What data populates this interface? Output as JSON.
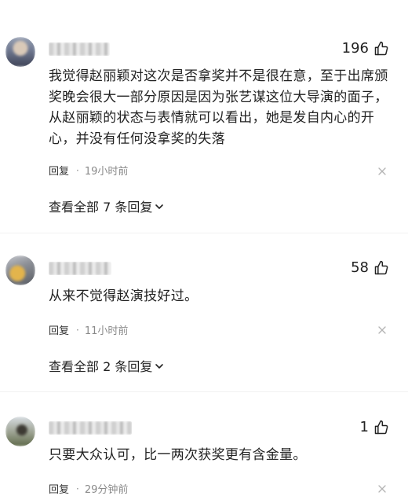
{
  "comments": [
    {
      "likes": "196",
      "text": "我觉得赵丽颖对这次是否拿奖并不是很在意，至于出席颁奖晚会很大一部分原因是因为张艺谋这位大导演的面子，从赵丽颖的状态与表情就可以看出，她是发自内心的开心，并没有任何没拿奖的失落",
      "reply_label": "回复",
      "separator": "·",
      "time": "19小时前",
      "view_all": "查看全部 7 条回复"
    },
    {
      "likes": "58",
      "text": "从来不觉得赵演技好过。",
      "reply_label": "回复",
      "separator": "·",
      "time": "11小时前",
      "view_all": "查看全部 2 条回复"
    },
    {
      "likes": "1",
      "text": "只要大众认可，比一两次获奖更有含金量。",
      "reply_label": "回复",
      "separator": "·",
      "time": "29分钟前"
    }
  ],
  "icons": {
    "like": "thumbs-up-icon",
    "close": "close-icon",
    "expand": "chevron-down-icon"
  }
}
